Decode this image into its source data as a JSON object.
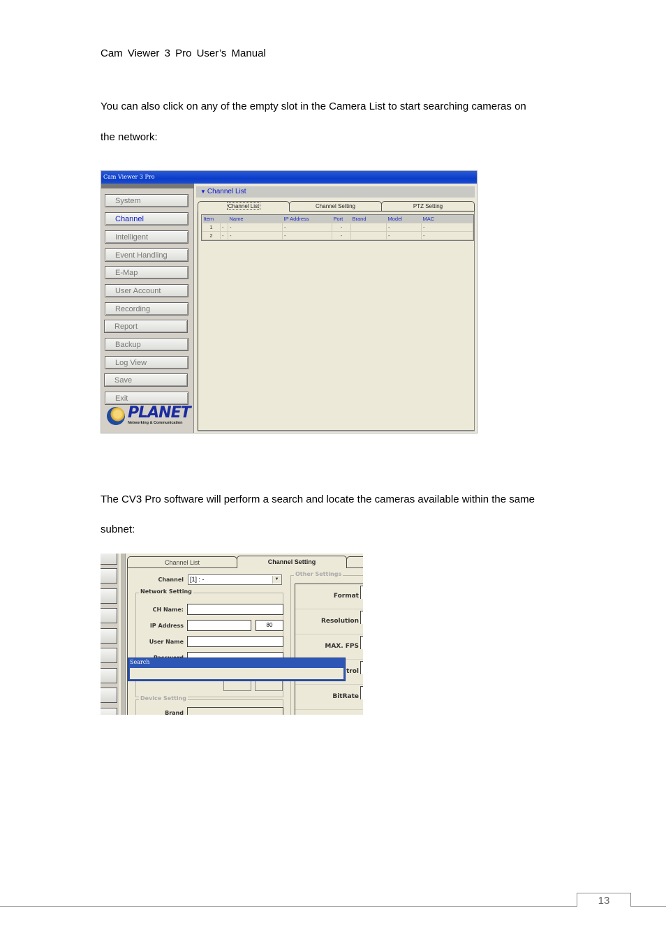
{
  "document": {
    "header": "Cam Viewer 3 Pro User’s Manual",
    "paragraph1_line1": "You can also click on any of the empty slot in the Camera List to start searching cameras on",
    "paragraph1_line2": "the network:",
    "paragraph2_line1": "The CV3 Pro software will perform a search and locate the cameras available within the same",
    "paragraph2_line2": "subnet:",
    "page_number": "13"
  },
  "screenshot1": {
    "window_title": "Cam Viewer 3 Pro",
    "sidebar": {
      "items": [
        {
          "label": "System",
          "active": false
        },
        {
          "label": "Channel",
          "active": true
        },
        {
          "label": "Intelligent",
          "active": false
        },
        {
          "label": "Event Handling",
          "active": false
        },
        {
          "label": "E-Map",
          "active": false
        },
        {
          "label": "User Account",
          "active": false
        },
        {
          "label": "Recording",
          "active": false
        },
        {
          "label": "Report",
          "active": false
        },
        {
          "label": "Backup",
          "active": false
        },
        {
          "label": "Log View",
          "active": false
        },
        {
          "label": "Save",
          "active": false
        },
        {
          "label": "Exit",
          "active": false
        }
      ],
      "logo_text": "PLANET",
      "logo_subtext": "Networking & Communication"
    },
    "section_title": "Channel List",
    "tabs": [
      {
        "label": "Channel List",
        "selected": true
      },
      {
        "label": "Channel Setting",
        "selected": false
      },
      {
        "label": "PTZ Setting",
        "selected": false
      }
    ],
    "table": {
      "columns": [
        "Item",
        "",
        "Name",
        "IP Address",
        "Port",
        "Brand",
        "Model",
        "MAC"
      ],
      "rows": [
        [
          "1",
          "-",
          "-",
          "-",
          "-",
          "",
          "-",
          "-"
        ],
        [
          "2",
          "-",
          "-",
          "-",
          "-",
          "",
          "-",
          "-"
        ]
      ]
    }
  },
  "screenshot2": {
    "tabs": [
      {
        "label": "Channel List",
        "selected": false
      },
      {
        "label": "Channel Setting",
        "selected": true
      },
      {
        "label": "",
        "selected": false
      }
    ],
    "channel_label": "Channel",
    "channel_value": "[1] : -",
    "network_setting": {
      "legend": "Network Setting",
      "ch_name_label": "CH Name:",
      "ch_name_value": "",
      "ip_label": "IP Address",
      "ip_value": "",
      "port_value": "80",
      "user_label": "User Name",
      "user_value": "",
      "password_label": "Password",
      "password_value": ""
    },
    "device_setting": {
      "legend": "Device Setting",
      "brand_label": "Brand",
      "brand_value": ""
    },
    "other_settings": {
      "legend": "Other Settings",
      "rows": [
        "Format",
        "Resolution",
        "MAX. FPS",
        "trol",
        "BitRate"
      ]
    },
    "search_dialog": {
      "title": "Search"
    }
  }
}
